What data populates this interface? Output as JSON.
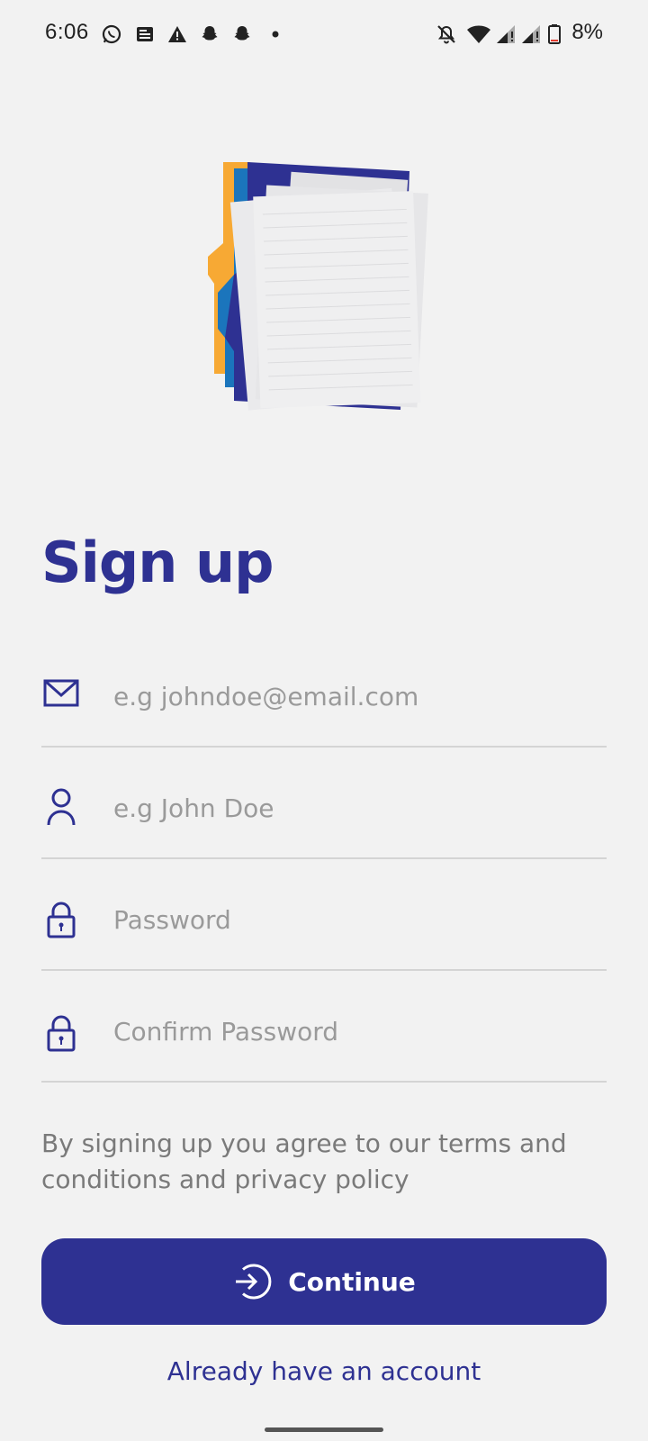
{
  "status_bar": {
    "time": "6:06",
    "battery": "8%",
    "left_icons": [
      "whatsapp-icon",
      "news-icon",
      "warning-icon",
      "snapchat-icon",
      "snapchat-icon",
      "dot-icon"
    ],
    "right_icons": [
      "bell-off-icon",
      "wifi-icon",
      "signal-icon",
      "signal-icon",
      "battery-icon"
    ]
  },
  "title": "Sign up",
  "form": {
    "email_placeholder": "e.g johndoe@email.com",
    "name_placeholder": "e.g John Doe",
    "password_placeholder": "Password",
    "confirm_password_placeholder": "Confirm Password"
  },
  "terms_text": "By signing up you agree to our terms and conditions and privacy policy",
  "continue_label": "Continue",
  "login_link": "Already have an account",
  "colors": {
    "primary": "#2e3192",
    "background": "#f2f2f2",
    "divider": "#d4d4d4",
    "placeholder": "#9a9a9a",
    "logo_orange": "#f7a934",
    "logo_blue": "#1b75bc"
  }
}
